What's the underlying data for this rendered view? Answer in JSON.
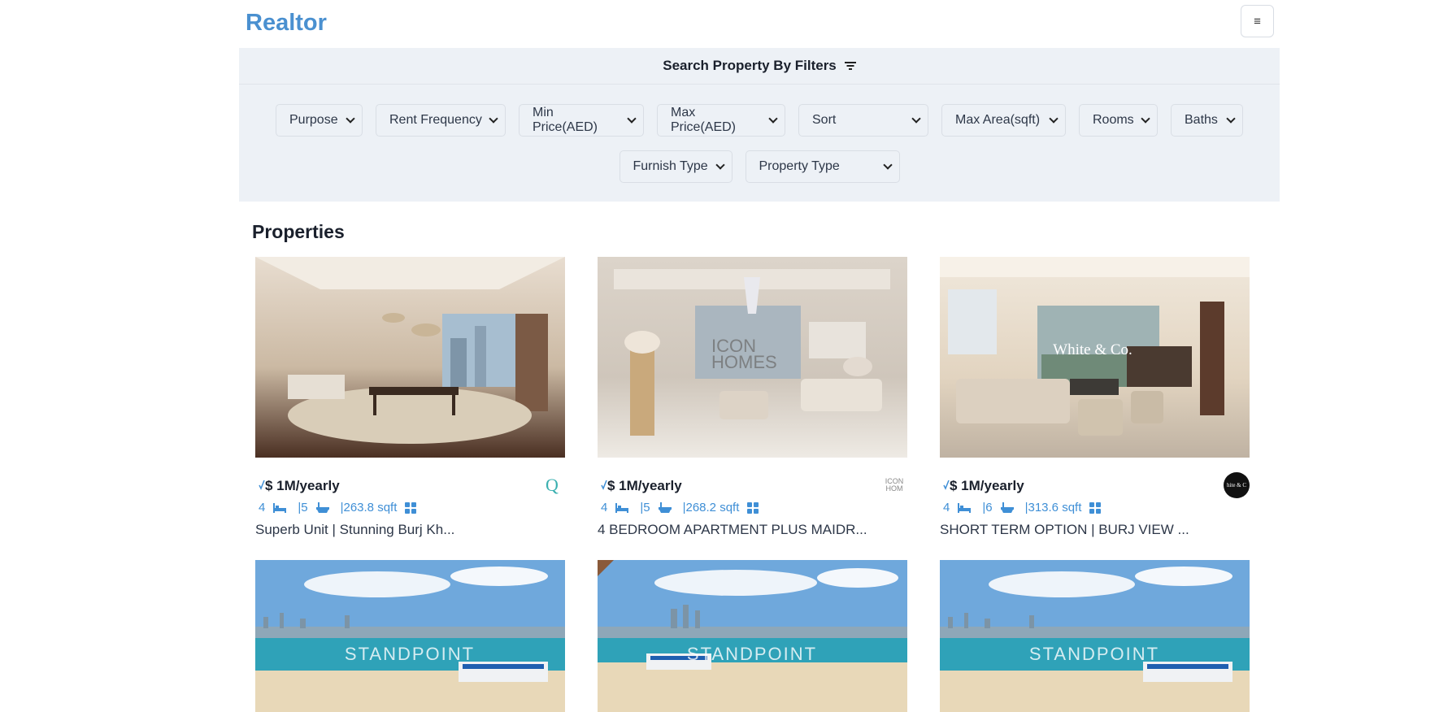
{
  "brand": "Realtor",
  "menu_icon": "hamburger-icon",
  "filters": {
    "title": "Search Property By Filters",
    "icon": "filter-icon",
    "row1": [
      "Purpose",
      "Rent Frequency",
      "Min Price(AED)",
      "Max Price(AED)",
      "Sort",
      "Max Area(sqft)",
      "Rooms",
      "Baths"
    ],
    "row2": [
      "Furnish Type",
      "Property Type"
    ]
  },
  "section_title": "Properties",
  "colors": {
    "brand": "#4a90d0",
    "accent": "#3f8fd6",
    "filter_bg": "#edf1f6"
  },
  "properties": [
    {
      "price": "$ 1M/yearly",
      "rooms": "4",
      "baths": "|5",
      "area": "|263.8 sqft",
      "title": "Superb Unit | Stunning Burj Kh...",
      "agency_mark": "Q",
      "photo_watermark": ""
    },
    {
      "price": "$ 1M/yearly",
      "rooms": "4",
      "baths": "|5",
      "area": "|268.2 sqft",
      "title": "4 BEDROOM APARTMENT PLUS MAIDR...",
      "agency_mark": "ICON HOM",
      "photo_watermark": "ICON HOMES"
    },
    {
      "price": "$ 1M/yearly",
      "rooms": "4",
      "baths": "|6",
      "area": "|313.6 sqft",
      "title": "SHORT TERM OPTION | BURJ VIEW ...",
      "agency_mark": "hite & C",
      "photo_watermark": "White & Co."
    },
    {
      "photo_watermark": "STANDPOINT"
    },
    {
      "photo_watermark": "STANDPOINT"
    },
    {
      "photo_watermark": "STANDPOINT"
    }
  ]
}
